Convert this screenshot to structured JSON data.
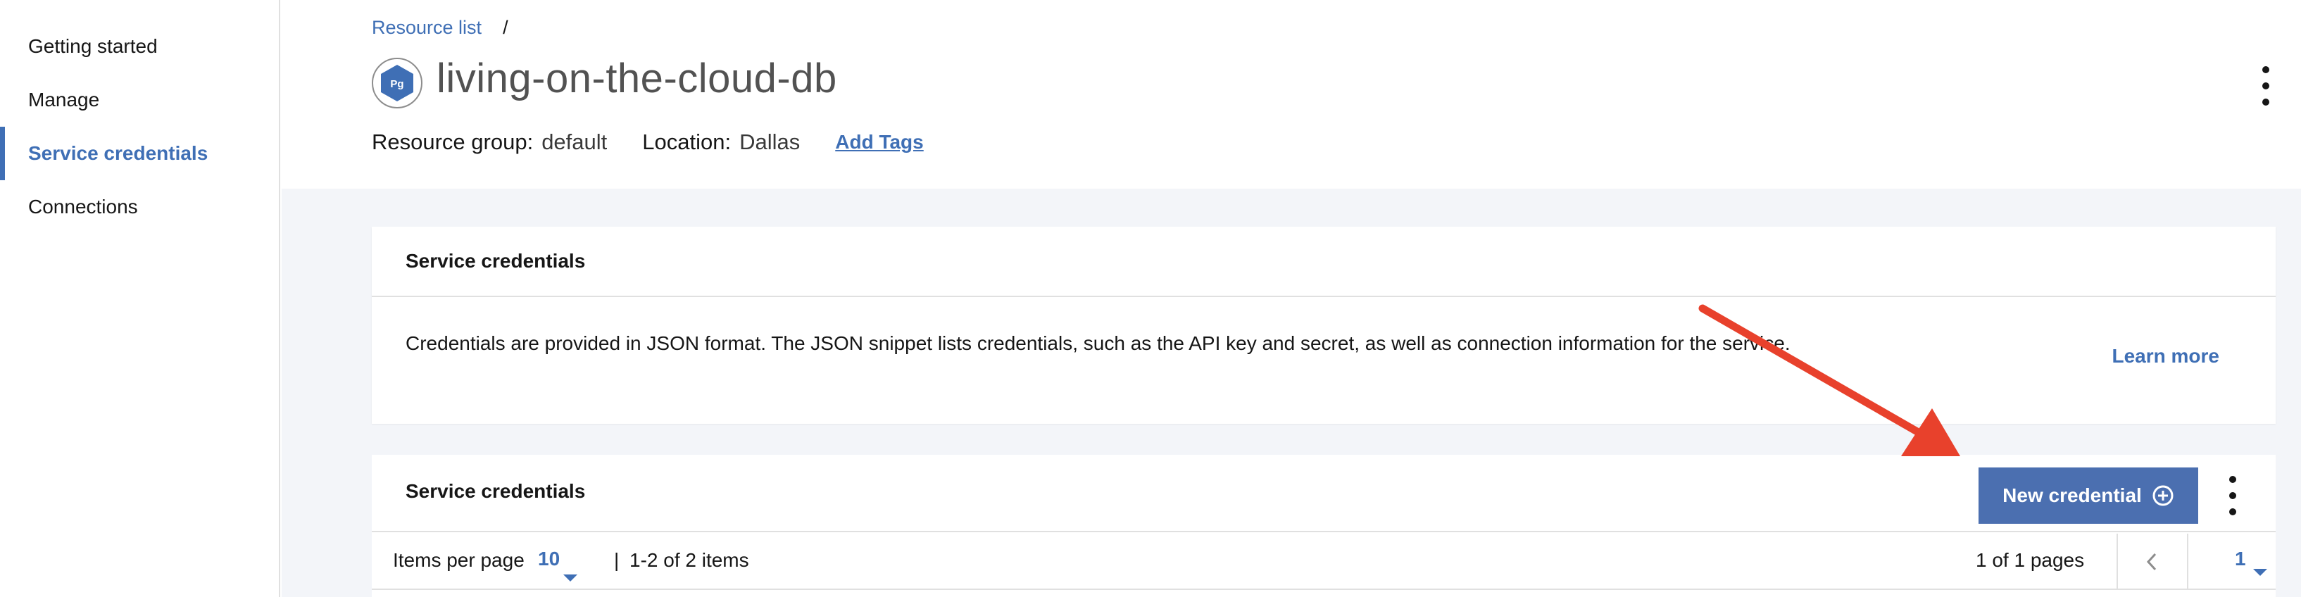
{
  "sidebar": {
    "items": [
      {
        "label": "Getting started",
        "active": false
      },
      {
        "label": "Manage",
        "active": false
      },
      {
        "label": "Service credentials",
        "active": true
      },
      {
        "label": "Connections",
        "active": false
      }
    ]
  },
  "breadcrumb": {
    "link": "Resource list",
    "separator": "/"
  },
  "header": {
    "icon_text": "Pg",
    "title": "living-on-the-cloud-db",
    "resource_group_label": "Resource group:",
    "resource_group_value": "default",
    "location_label": "Location:",
    "location_value": "Dallas",
    "add_tags": "Add Tags"
  },
  "info_card": {
    "title": "Service credentials",
    "description": "Credentials are provided in JSON format. The JSON snippet lists credentials, such as the API key and secret, as well as connection information for the service.",
    "learn_more": "Learn more"
  },
  "credentials_card": {
    "title": "Service credentials",
    "new_credential_label": "New credential",
    "pagination": {
      "items_per_page_label": "Items per page",
      "items_per_page_value": "10",
      "separator": "|",
      "items_range": "1-2 of 2 items",
      "pages_text": "1 of 1 pages",
      "current_page": "1"
    }
  },
  "colors": {
    "accent": "#3f6fb5",
    "button": "#4b6fb0",
    "arrow": "#e8412c",
    "content_bg": "#f3f5f9"
  }
}
